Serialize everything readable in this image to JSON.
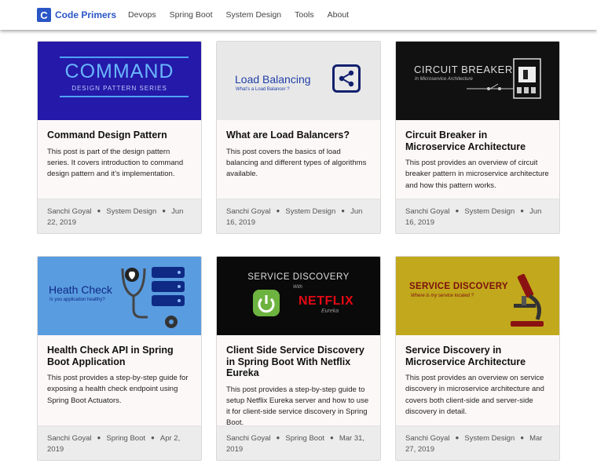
{
  "header": {
    "logo_letter": "C",
    "brand": "Code Primers",
    "nav": [
      "Devops",
      "Spring Boot",
      "System Design",
      "Tools",
      "About"
    ]
  },
  "posts": [
    {
      "title": "Command Design Pattern",
      "description": "This post is part of the design pattern series. It covers introduction to command design pattern and it’s implementation.",
      "author": "Sanchi Goyal",
      "category": "System Design",
      "date": "Jun 22, 2019",
      "image": {
        "line1": "COMMAND",
        "line2": "DESIGN PATTERN SERIES"
      }
    },
    {
      "title": "What are Load Balancers?",
      "description": "This post covers the basics of load balancing and different types of algorithms available.",
      "author": "Sanchi Goyal",
      "category": "System Design",
      "date": "Jun 16, 2019",
      "image": {
        "line1": "Load Balancing",
        "line2": "What’s a Load Balancer ?",
        "icon": "share-icon"
      }
    },
    {
      "title": "Circuit Breaker in Microservice Architecture",
      "description": "This post provides an overview of circuit breaker pattern in microservice architecture and how this pattern works.",
      "author": "Sanchi Goyal",
      "category": "System Design",
      "date": "Jun 16, 2019",
      "image": {
        "line1": "CIRCUIT BREAKER",
        "line2": "In Microservice Architecture",
        "icon": "breaker-icon"
      }
    },
    {
      "title": "Health Check API in Spring Boot Application",
      "description": "This post provides a step-by-step guide for exposing a health check endpoint using Spring Boot Actuators.",
      "author": "Sanchi Goyal",
      "category": "Spring Boot",
      "date": "Apr 2, 2019",
      "image": {
        "line1": "Heath Check",
        "line2": "Is you application healthy?",
        "icon": "stethoscope-server-icon"
      }
    },
    {
      "title": "Client Side Service Discovery in Spring Boot With Netflix Eureka",
      "description": "This post provides a step-by-step guide to setup Netflix Eureka server and how to use it for client-side service discovery in Spring Boot.",
      "author": "Sanchi Goyal",
      "category": "Spring Boot",
      "date": "Mar 31, 2019",
      "image": {
        "line1": "SERVICE DISCOVERY",
        "with": "With",
        "line2": "NETFLIX",
        "line3": "Eureka",
        "icon": "spring-power-icon"
      }
    },
    {
      "title": "Service Discovery in Microservice Architecture",
      "description": "This post provides an overview on service discovery in microservice architecture and covers both client-side and server-side discovery in detail.",
      "author": "Sanchi Goyal",
      "category": "System Design",
      "date": "Mar 27, 2019",
      "image": {
        "line1": "SERVICE DISCOVERY",
        "line2": "Where is my service located ?",
        "icon": "microscope-icon"
      }
    }
  ],
  "colors": {
    "brand": "#2a56c6",
    "card_bg": "#fdf8f8",
    "footer_bg": "#ececec"
  }
}
